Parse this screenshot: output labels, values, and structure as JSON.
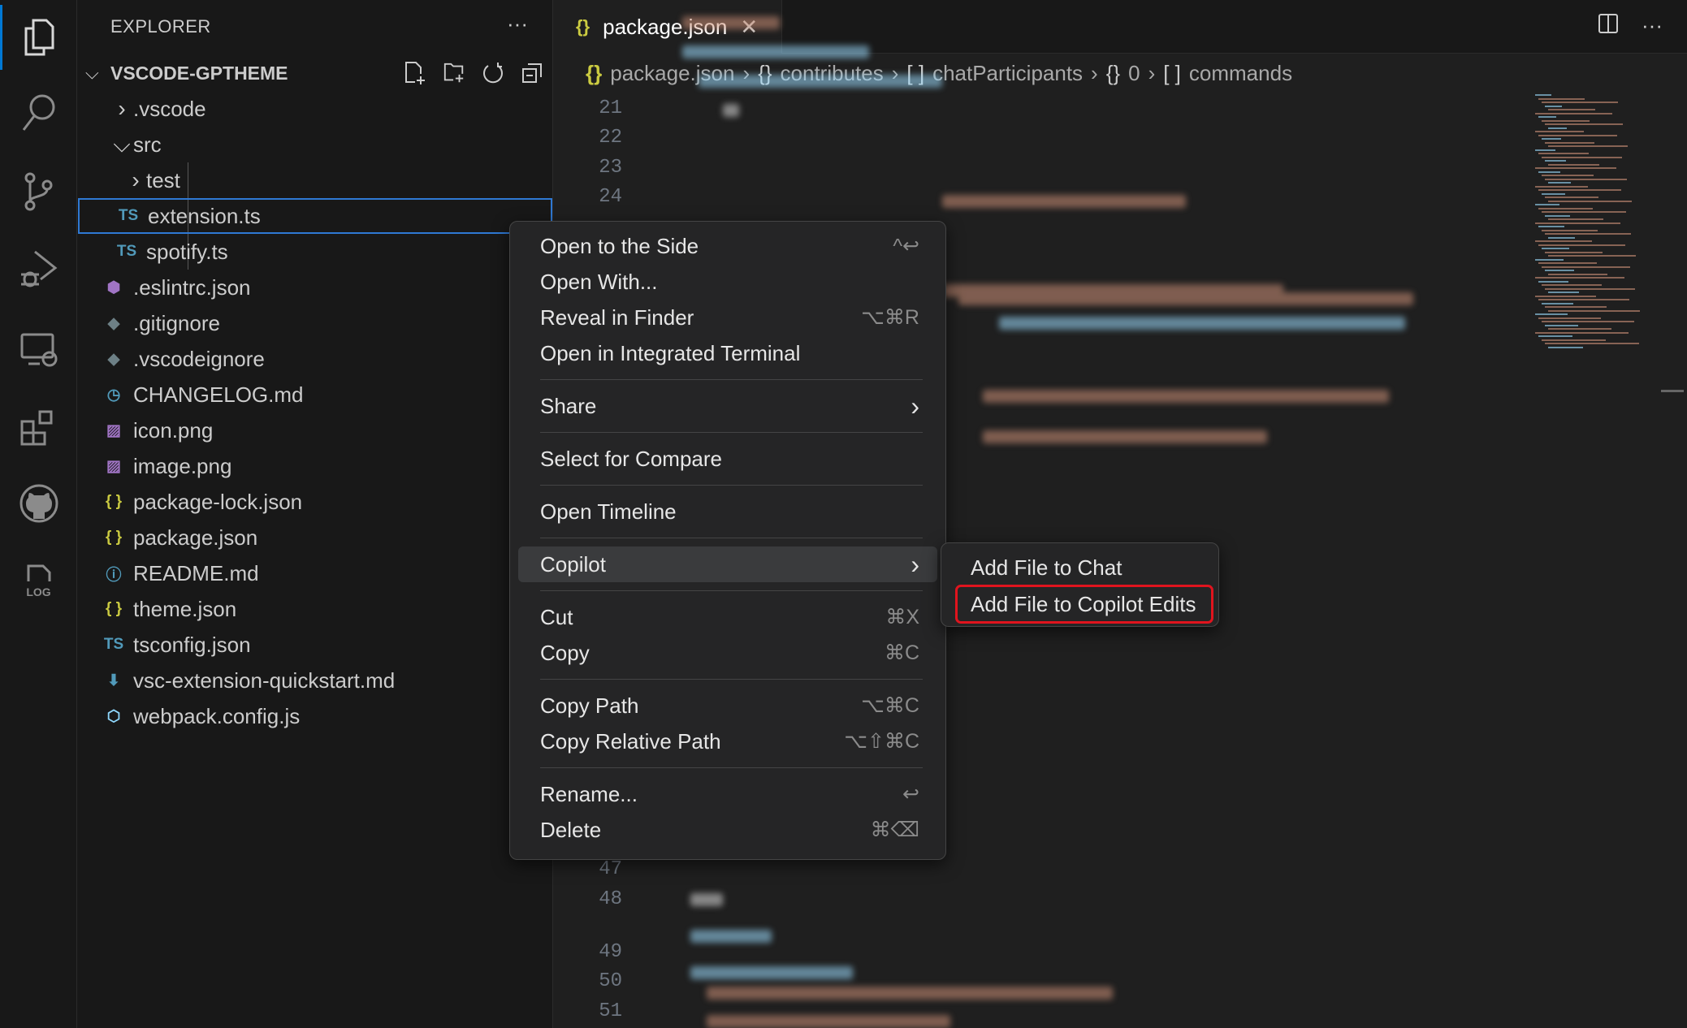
{
  "activity_bar": [
    "files-icon",
    "search-icon",
    "source-control-icon",
    "run-debug-icon",
    "remote-explorer-icon",
    "extensions-icon",
    "github-icon",
    "log-icon"
  ],
  "log_label": "LOG",
  "sidebar": {
    "title": "EXPLORER",
    "folder": "VSCODE-GPTHEME",
    "items": [
      {
        "label": ".vscode",
        "type": "folder",
        "expanded": false,
        "depth": 0
      },
      {
        "label": "src",
        "type": "folder",
        "expanded": true,
        "depth": 0
      },
      {
        "label": "test",
        "type": "folder",
        "expanded": false,
        "depth": 1
      },
      {
        "label": "extension.ts",
        "icon": "TS",
        "depth": 1,
        "selected": true
      },
      {
        "label": "spotify.ts",
        "icon": "TS",
        "depth": 1
      },
      {
        "label": ".eslintrc.json",
        "icon": "eslint",
        "depth": 0
      },
      {
        "label": ".gitignore",
        "icon": "git",
        "depth": 0
      },
      {
        "label": ".vscodeignore",
        "icon": "git",
        "depth": 0
      },
      {
        "label": "CHANGELOG.md",
        "icon": "clock",
        "depth": 0
      },
      {
        "label": "icon.png",
        "icon": "image",
        "depth": 0
      },
      {
        "label": "image.png",
        "icon": "image",
        "depth": 0
      },
      {
        "label": "package-lock.json",
        "icon": "{}",
        "depth": 0
      },
      {
        "label": "package.json",
        "icon": "{}",
        "depth": 0
      },
      {
        "label": "README.md",
        "icon": "info",
        "depth": 0
      },
      {
        "label": "theme.json",
        "icon": "{}",
        "depth": 0
      },
      {
        "label": "tsconfig.json",
        "icon": "TS",
        "depth": 0
      },
      {
        "label": "vsc-extension-quickstart.md",
        "icon": "download",
        "depth": 0
      },
      {
        "label": "webpack.config.js",
        "icon": "cube",
        "depth": 0
      }
    ]
  },
  "tab": {
    "title": "package.json",
    "icon": "{}"
  },
  "breadcrumbs": [
    {
      "sym": "{}",
      "label": "package.json"
    },
    {
      "sym": "{}",
      "label": "contributes"
    },
    {
      "sym": "[ ]",
      "label": "chatParticipants"
    },
    {
      "sym": "{}",
      "label": "0"
    },
    {
      "sym": "[ ]",
      "label": "commands"
    }
  ],
  "line_numbers": [
    "21",
    "22",
    "23",
    "24",
    "47",
    "48",
    "49",
    "50",
    "51"
  ],
  "context_menu": [
    {
      "label": "Open to the Side",
      "kb": "^↩"
    },
    {
      "label": "Open With...",
      "kb": ""
    },
    {
      "label": "Reveal in Finder",
      "kb": "⌥⌘R"
    },
    {
      "label": "Open in Integrated Terminal",
      "kb": ""
    },
    {
      "label": "Share",
      "kb": "›"
    },
    {
      "label": "Select for Compare",
      "kb": ""
    },
    {
      "label": "Open Timeline",
      "kb": ""
    },
    {
      "label": "Copilot",
      "kb": "›"
    },
    {
      "label": "Cut",
      "kb": "⌘X"
    },
    {
      "label": "Copy",
      "kb": "⌘C"
    },
    {
      "label": "Copy Path",
      "kb": "⌥⌘C"
    },
    {
      "label": "Copy Relative Path",
      "kb": "⌥⇧⌘C"
    },
    {
      "label": "Rename...",
      "kb": "↩"
    },
    {
      "label": "Delete",
      "kb": "⌘⌫"
    }
  ],
  "submenu": [
    {
      "label": "Add File to Chat"
    },
    {
      "label": "Add File to Copilot Edits",
      "highlighted": true
    }
  ],
  "colors": {
    "accent": "#0078d4",
    "selection_border": "#2f79d4",
    "highlight_box": "#e0141e",
    "json_icon": "#cbcb41",
    "ts_icon": "#519aba"
  }
}
